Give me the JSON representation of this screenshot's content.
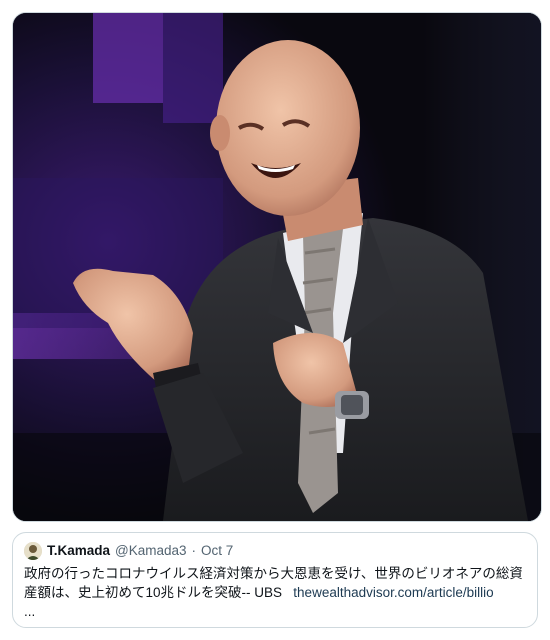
{
  "media": {
    "image_description_icon": "photo-laughing-man-icon",
    "colors": {
      "background": "#0b0a16",
      "stage_light": "#5b2a9e",
      "suit": "#2a2b2e"
    }
  },
  "quote": {
    "author_name": "T.Kamada",
    "author_handle": "@Kamada3",
    "separator": "·",
    "date": "Oct 7",
    "text": "政府の行ったコロナウイルス経済対策から大恩恵を受け、世界のビリオネアの総資産額は、史上初めて10兆ドルを突破-- UBS",
    "link_text": "thewealthadvisor.com/article/billio",
    "truncation": "..."
  },
  "colors": {
    "card_border": "#cfd9de",
    "secondary_text": "#536471",
    "primary_text": "#0f1419"
  }
}
